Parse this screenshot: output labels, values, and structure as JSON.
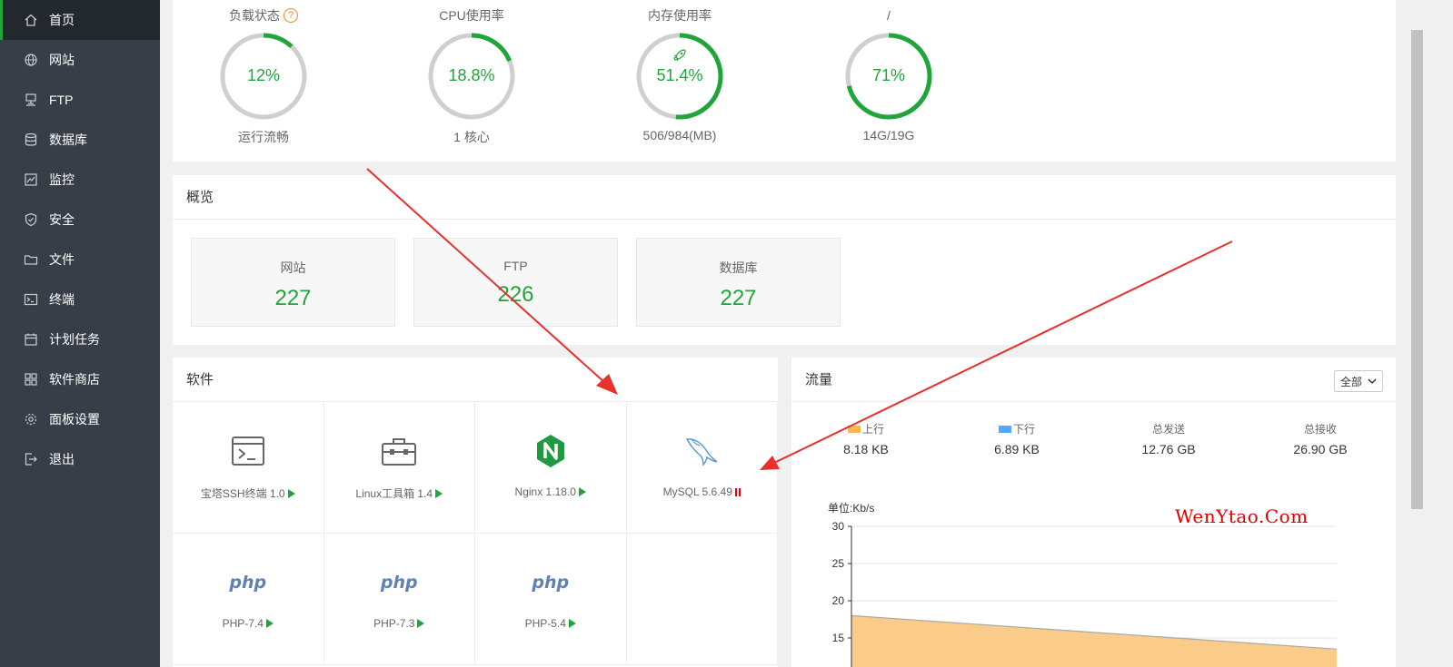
{
  "sidebar": {
    "items": [
      {
        "label": "首页",
        "icon": "home-icon",
        "active": true
      },
      {
        "label": "网站",
        "icon": "globe-icon"
      },
      {
        "label": "FTP",
        "icon": "ftp-icon"
      },
      {
        "label": "数据库",
        "icon": "database-icon"
      },
      {
        "label": "监控",
        "icon": "monitor-icon"
      },
      {
        "label": "安全",
        "icon": "shield-icon"
      },
      {
        "label": "文件",
        "icon": "folder-icon"
      },
      {
        "label": "终端",
        "icon": "terminal-icon"
      },
      {
        "label": "计划任务",
        "icon": "calendar-icon"
      },
      {
        "label": "软件商店",
        "icon": "grid-icon"
      },
      {
        "label": "面板设置",
        "icon": "gear-icon"
      },
      {
        "label": "退出",
        "icon": "logout-icon"
      }
    ]
  },
  "status": {
    "gauges": [
      {
        "title": "负载状态",
        "value": "12%",
        "percent": 12,
        "sub": "运行流畅",
        "help": "?"
      },
      {
        "title": "CPU使用率",
        "value": "18.8%",
        "percent": 18.8,
        "sub": "1 核心"
      },
      {
        "title": "内存使用率",
        "value": "51.4%",
        "percent": 51.4,
        "sub": "506/984(MB)",
        "icon": "rocket-icon"
      },
      {
        "title": "/",
        "value": "71%",
        "percent": 71,
        "sub": "14G/19G"
      }
    ]
  },
  "overview": {
    "title": "概览",
    "boxes": [
      {
        "label": "网站",
        "value": "227"
      },
      {
        "label": "FTP",
        "value": "226"
      },
      {
        "label": "数据库",
        "value": "227"
      }
    ]
  },
  "software": {
    "title": "软件",
    "items": [
      {
        "label": "宝塔SSH终端 1.0",
        "icon": "terminal-window-icon",
        "state": "play"
      },
      {
        "label": "Linux工具箱 1.4",
        "icon": "toolbox-icon",
        "state": "play"
      },
      {
        "label": "Nginx 1.18.0",
        "icon": "nginx-icon",
        "state": "play"
      },
      {
        "label": "MySQL 5.6.49",
        "icon": "mysql-dolphin-icon",
        "state": "pause"
      },
      {
        "label": "PHP-7.4",
        "icon": "php-icon",
        "logo": "php",
        "state": "play"
      },
      {
        "label": "PHP-7.3",
        "icon": "php-icon",
        "logo": "php",
        "state": "play"
      },
      {
        "label": "PHP-5.4",
        "icon": "php-icon",
        "logo": "php",
        "state": "play"
      }
    ]
  },
  "traffic": {
    "title": "流量",
    "select": "全部",
    "stats": [
      {
        "label": "上行",
        "value": "8.18 KB",
        "color": "#f7b851"
      },
      {
        "label": "下行",
        "value": "6.89 KB",
        "color": "#52a9ff"
      },
      {
        "label": "总发送",
        "value": "12.76 GB"
      },
      {
        "label": "总接收",
        "value": "26.90 GB"
      }
    ],
    "unit": "单位:Kb/s",
    "ticks": [
      "30",
      "25",
      "20",
      "15"
    ],
    "watermark": "WenYtao.Com"
  },
  "chart_data": {
    "type": "area",
    "ylabel": "单位:Kb/s",
    "ylim": [
      13,
      30
    ],
    "yticks": [
      30,
      25,
      20,
      15
    ],
    "series": [
      {
        "name": "上行",
        "color": "#f7b851",
        "x": [
          0,
          1
        ],
        "values": [
          18,
          13.5
        ]
      }
    ]
  }
}
